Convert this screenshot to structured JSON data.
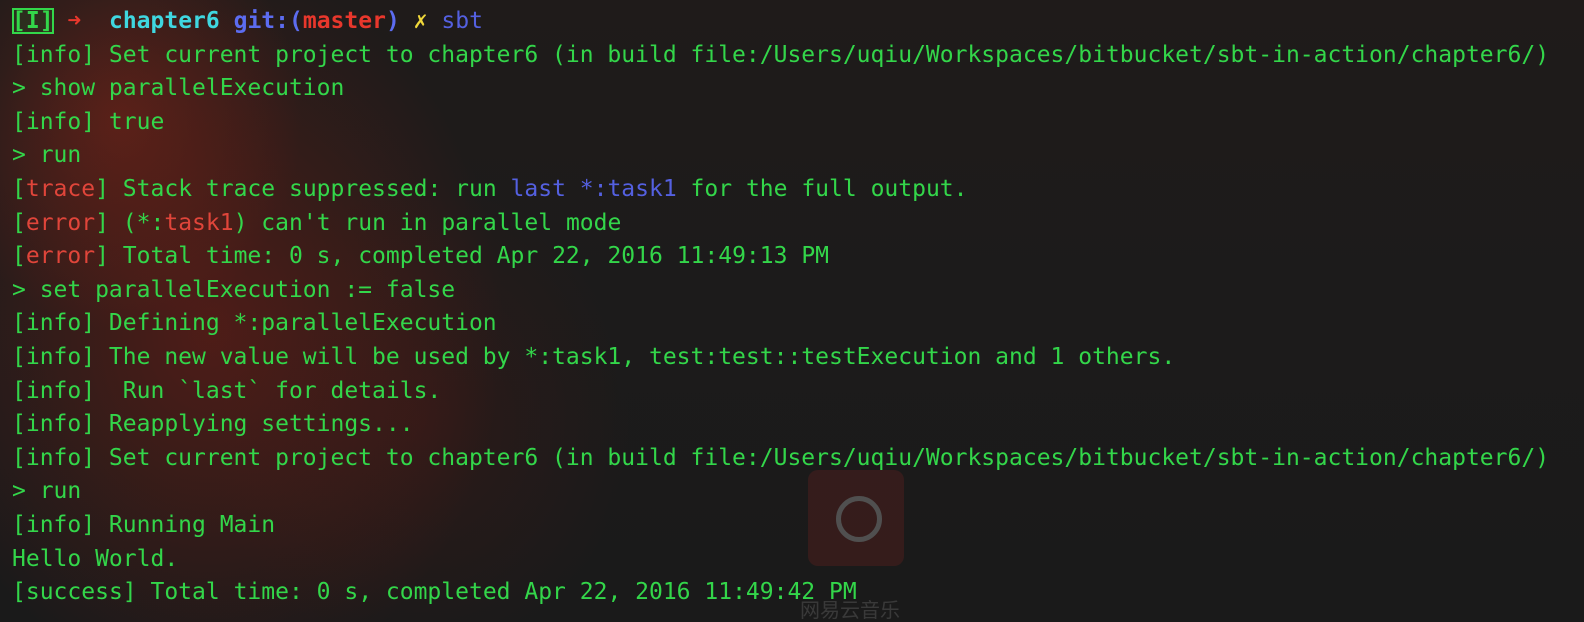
{
  "app_watermark": {
    "text": "网易云音乐"
  },
  "lines": [
    {
      "kind": "shell-prompt",
      "segments": [
        {
          "text": "[I]",
          "color": "mode-badge"
        },
        {
          "text": " ",
          "color": "green"
        },
        {
          "text": "➜",
          "color": "arrow"
        },
        {
          "text": "  ",
          "color": "green"
        },
        {
          "text": "chapter6",
          "color": "cyan-bold"
        },
        {
          "text": " ",
          "color": "green"
        },
        {
          "text": "git:(",
          "color": "blue-bold"
        },
        {
          "text": "master",
          "color": "red-bold"
        },
        {
          "text": ")",
          "color": "blue-bold"
        },
        {
          "text": " ",
          "color": "green"
        },
        {
          "text": "✗",
          "color": "yellow"
        },
        {
          "text": " sbt",
          "color": "blue"
        }
      ]
    },
    {
      "kind": "output",
      "segments": [
        {
          "text": "[info] Set current project to chapter6 (in build file:/Users/uqiu/Workspaces/bitbucket/sbt-in-action/chapter6/)",
          "color": "green"
        }
      ]
    },
    {
      "kind": "sbt-prompt",
      "segments": [
        {
          "text": "> show parallelExecution",
          "color": "green"
        }
      ]
    },
    {
      "kind": "output",
      "segments": [
        {
          "text": "[info] true",
          "color": "green"
        }
      ]
    },
    {
      "kind": "sbt-prompt",
      "segments": [
        {
          "text": "> run",
          "color": "green"
        }
      ]
    },
    {
      "kind": "output",
      "segments": [
        {
          "text": "[",
          "color": "green"
        },
        {
          "text": "trace",
          "color": "red"
        },
        {
          "text": "] Stack trace suppressed: run ",
          "color": "green"
        },
        {
          "text": "last *:task1",
          "color": "blue"
        },
        {
          "text": " for the full output.",
          "color": "green"
        }
      ]
    },
    {
      "kind": "output",
      "segments": [
        {
          "text": "[",
          "color": "green"
        },
        {
          "text": "error",
          "color": "red"
        },
        {
          "text": "] (*:",
          "color": "green"
        },
        {
          "text": "task1",
          "color": "red"
        },
        {
          "text": ") can't run in parallel mode",
          "color": "green"
        }
      ]
    },
    {
      "kind": "output",
      "segments": [
        {
          "text": "[",
          "color": "green"
        },
        {
          "text": "error",
          "color": "red"
        },
        {
          "text": "] Total time: 0 s, completed Apr 22, 2016 11:49:13 PM",
          "color": "green"
        }
      ]
    },
    {
      "kind": "sbt-prompt",
      "segments": [
        {
          "text": "> set parallelExecution := false",
          "color": "green"
        }
      ]
    },
    {
      "kind": "output",
      "segments": [
        {
          "text": "[info] Defining *:parallelExecution",
          "color": "green"
        }
      ]
    },
    {
      "kind": "output",
      "segments": [
        {
          "text": "[info] The new value will be used by *:task1, test:test::testExecution and 1 others.",
          "color": "green"
        }
      ]
    },
    {
      "kind": "output",
      "segments": [
        {
          "text": "[info]  Run `last` for details.",
          "color": "green"
        }
      ]
    },
    {
      "kind": "output",
      "segments": [
        {
          "text": "[info] Reapplying settings...",
          "color": "green"
        }
      ]
    },
    {
      "kind": "output",
      "segments": [
        {
          "text": "[info] Set current project to chapter6 (in build file:/Users/uqiu/Workspaces/bitbucket/sbt-in-action/chapter6/)",
          "color": "green"
        }
      ]
    },
    {
      "kind": "sbt-prompt",
      "segments": [
        {
          "text": "> run",
          "color": "green"
        }
      ]
    },
    {
      "kind": "output",
      "segments": [
        {
          "text": "[info] Running Main",
          "color": "green"
        }
      ]
    },
    {
      "kind": "output",
      "segments": [
        {
          "text": "Hello World.",
          "color": "green"
        }
      ]
    },
    {
      "kind": "output",
      "segments": [
        {
          "text": "[",
          "color": "green"
        },
        {
          "text": "success",
          "color": "green"
        },
        {
          "text": "] Total time: 0 s, completed Apr 22, 2016 11:49:42 PM",
          "color": "green"
        }
      ]
    }
  ]
}
